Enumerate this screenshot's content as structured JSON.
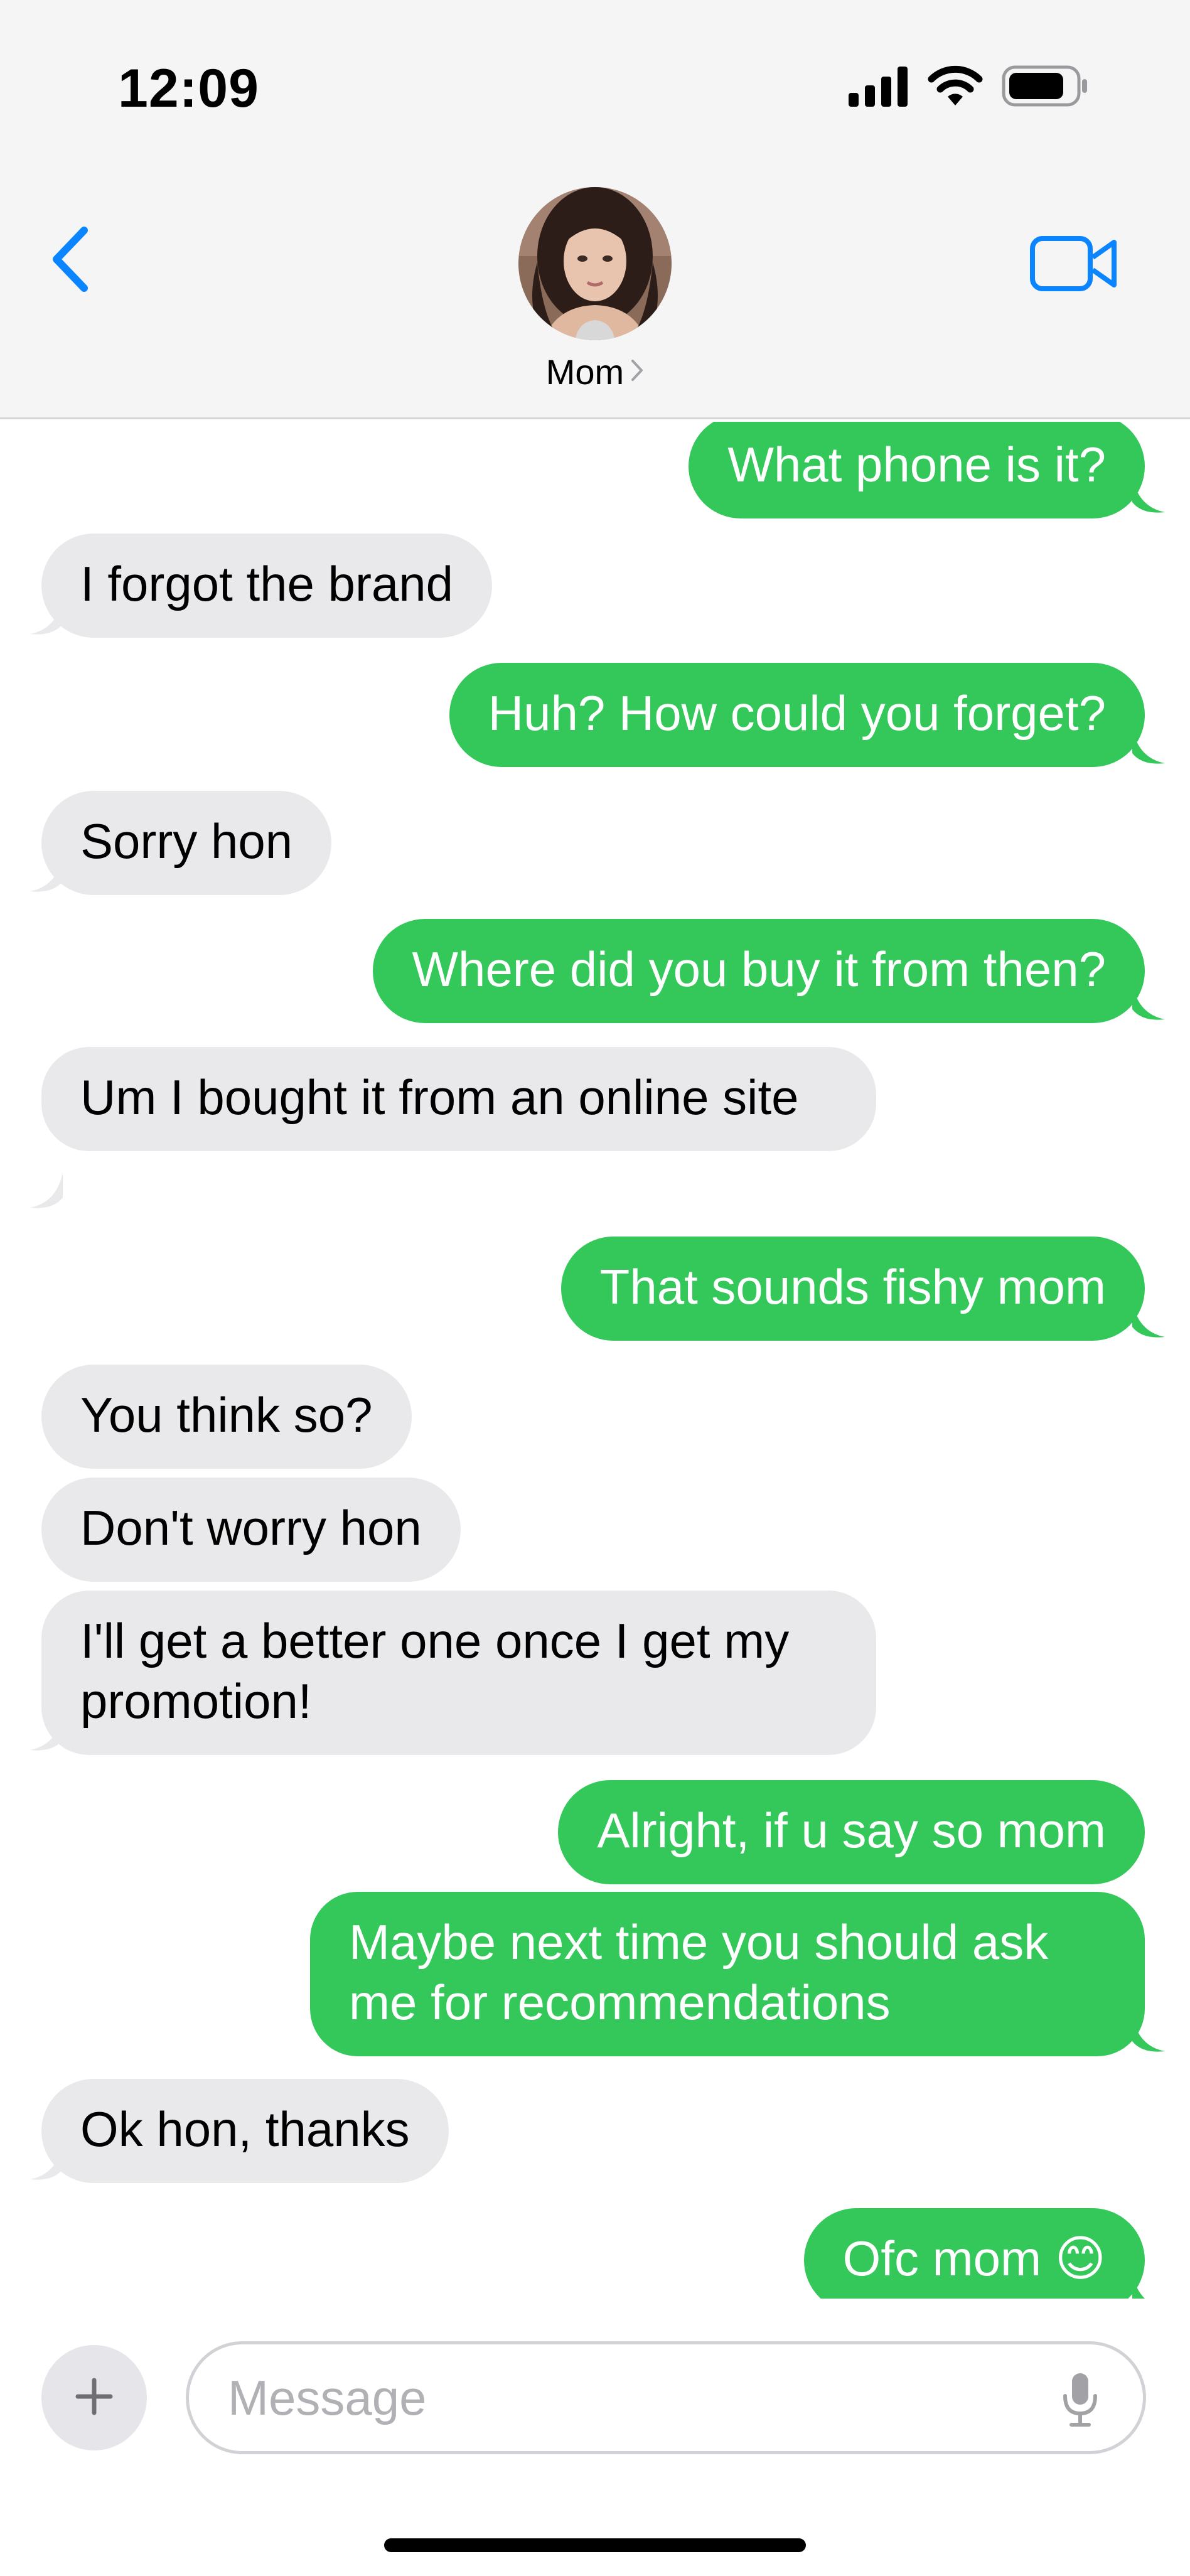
{
  "status_bar": {
    "time": "12:09",
    "icons": [
      "cellular-signal-icon",
      "wifi-icon",
      "battery-icon"
    ]
  },
  "header": {
    "contact_name": "Mom",
    "back_icon": "chevron-left-icon",
    "video_icon": "video-camera-icon",
    "name_chevron_icon": "chevron-right-icon"
  },
  "messages": [
    {
      "dir": "out",
      "text": "What phone is it?"
    },
    {
      "dir": "in",
      "text": "I forgot the brand"
    },
    {
      "dir": "out",
      "text": "Huh? How could you forget?"
    },
    {
      "dir": "in",
      "text": "Sorry hon"
    },
    {
      "dir": "out",
      "text": "Where did you buy it from then?"
    },
    {
      "dir": "in",
      "text": "Um I bought it from an online site"
    },
    {
      "dir": "out",
      "text": "That sounds fishy mom"
    },
    {
      "dir": "in",
      "text": "You think so?"
    },
    {
      "dir": "in",
      "text": "Don't worry hon"
    },
    {
      "dir": "in",
      "text": "I'll get a better one once I get my promotion!"
    },
    {
      "dir": "out",
      "text": "Alright, if u say so mom"
    },
    {
      "dir": "out",
      "text": "Maybe next time you should ask me for recommendations"
    },
    {
      "dir": "in",
      "text": "Ok hon, thanks"
    },
    {
      "dir": "out",
      "text": "Ofc mom 😊"
    }
  ],
  "composer": {
    "placeholder": "Message",
    "plus_icon": "plus-icon",
    "mic_icon": "microphone-icon"
  },
  "colors": {
    "outgoing_bubble": "#34c759",
    "incoming_bubble": "#e9e9eb",
    "accent": "#0a84ff",
    "header_bg": "#f5f5f5"
  }
}
